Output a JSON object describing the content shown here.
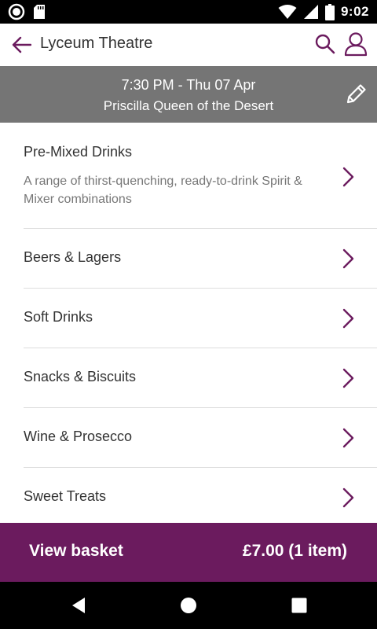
{
  "status_bar": {
    "time": "9:02",
    "icons": [
      "record-icon",
      "sd-card-icon",
      "wifi-icon",
      "signal-icon",
      "battery-icon"
    ]
  },
  "header": {
    "title": "Lyceum Theatre",
    "icons": [
      "back-arrow-icon",
      "search-icon",
      "user-icon"
    ],
    "accent_color": "#6b1b5e"
  },
  "event": {
    "datetime": "7:30 PM - Thu 07 Apr",
    "show_name": "Priscilla Queen of the Desert",
    "edit_icon": "pencil-icon",
    "background_color": "#757575"
  },
  "categories": [
    {
      "title": "Pre-Mixed Drinks",
      "description": "A range of thirst-quenching, ready-to-drink Spirit & Mixer combinations"
    },
    {
      "title": "Beers & Lagers"
    },
    {
      "title": "Soft Drinks"
    },
    {
      "title": "Snacks & Biscuits"
    },
    {
      "title": "Wine & Prosecco"
    },
    {
      "title": "Sweet Treats"
    }
  ],
  "basket": {
    "label": "View basket",
    "total": "£7.00 (1 item)",
    "background_color": "#6b1b5e"
  },
  "nav_bar": {
    "icons": [
      "back-triangle-icon",
      "home-circle-icon",
      "recents-square-icon"
    ]
  }
}
